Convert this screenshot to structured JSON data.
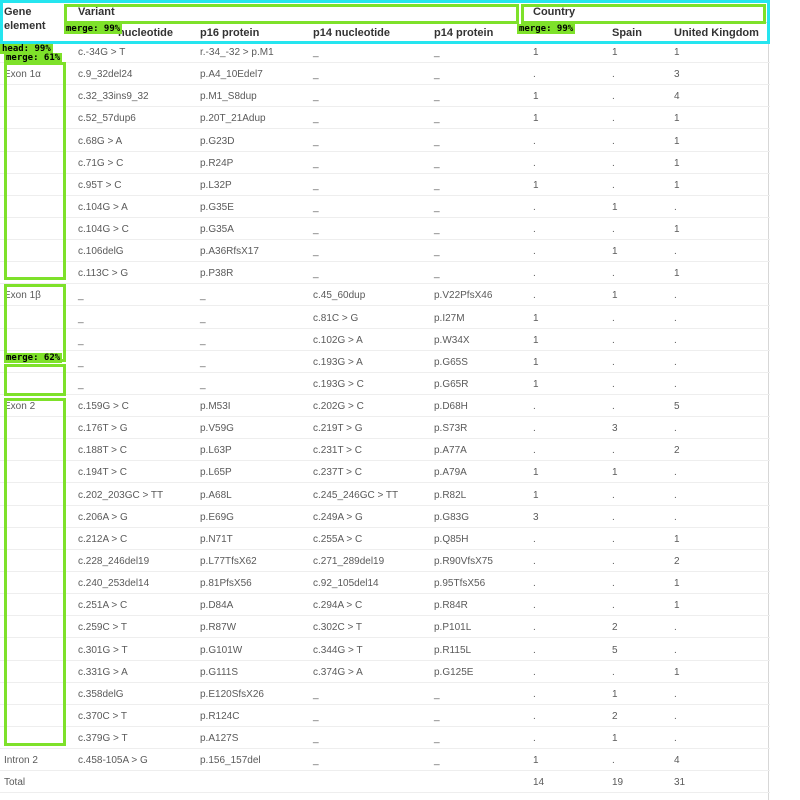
{
  "header": {
    "gene_element_line1": "Gene",
    "gene_element_line2": "element",
    "variant": "Variant",
    "country": "Country",
    "columns": [
      "nucleotide",
      "p16 protein",
      "p14 nucleotide",
      "p14 protein",
      "",
      "Spain",
      "United Kingdom"
    ]
  },
  "rows": [
    {
      "group": "",
      "c1": "c.-34G > T",
      "c2": "r.-34_-32 > p.M1",
      "c3": "_",
      "c4": "_",
      "c5": "1",
      "c6": "1",
      "c7": "1"
    },
    {
      "group": "Exon 1α",
      "c1": "c.9_32del24",
      "c2": "p.A4_10Edel7",
      "c3": "_",
      "c4": "_",
      "c5": ".",
      "c6": ".",
      "c7": "3"
    },
    {
      "group": "",
      "c1": "c.32_33ins9_32",
      "c2": "p.M1_S8dup",
      "c3": "_",
      "c4": "_",
      "c5": "1",
      "c6": ".",
      "c7": "4"
    },
    {
      "group": "",
      "c1": "c.52_57dup6",
      "c2": "p.20T_21Adup",
      "c3": "_",
      "c4": "_",
      "c5": "1",
      "c6": ".",
      "c7": "1"
    },
    {
      "group": "",
      "c1": "c.68G > A",
      "c2": "p.G23D",
      "c3": "_",
      "c4": "_",
      "c5": ".",
      "c6": ".",
      "c7": "1"
    },
    {
      "group": "",
      "c1": "c.71G > C",
      "c2": "p.R24P",
      "c3": "_",
      "c4": "_",
      "c5": ".",
      "c6": ".",
      "c7": "1"
    },
    {
      "group": "",
      "c1": "c.95T > C",
      "c2": "p.L32P",
      "c3": "_",
      "c4": "_",
      "c5": "1",
      "c6": ".",
      "c7": "1"
    },
    {
      "group": "",
      "c1": "c.104G > A",
      "c2": "p.G35E",
      "c3": "_",
      "c4": "_",
      "c5": ".",
      "c6": "1",
      "c7": "."
    },
    {
      "group": "",
      "c1": "c.104G > C",
      "c2": "p.G35A",
      "c3": "_",
      "c4": "_",
      "c5": ".",
      "c6": ".",
      "c7": "1"
    },
    {
      "group": "",
      "c1": "c.106delG",
      "c2": "p.A36RfsX17",
      "c3": "_",
      "c4": "_",
      "c5": ".",
      "c6": "1",
      "c7": "."
    },
    {
      "group": "",
      "c1": "c.113C > G",
      "c2": "p.P38R",
      "c3": "_",
      "c4": "_",
      "c5": ".",
      "c6": ".",
      "c7": "1"
    },
    {
      "group": "Exon 1β",
      "c1": "_",
      "c2": "_",
      "c3": "c.45_60dup",
      "c4": "p.V22PfsX46",
      "c5": ".",
      "c6": "1",
      "c7": "."
    },
    {
      "group": "",
      "c1": "_",
      "c2": "_",
      "c3": "c.81C > G",
      "c4": "p.I27M",
      "c5": "1",
      "c6": ".",
      "c7": "."
    },
    {
      "group": "",
      "c1": "_",
      "c2": "_",
      "c3": "c.102G > A",
      "c4": "p.W34X",
      "c5": "1",
      "c6": ".",
      "c7": "."
    },
    {
      "group": "",
      "c1": "_",
      "c2": "_",
      "c3": "c.193G > A",
      "c4": "p.G65S",
      "c5": "1",
      "c6": ".",
      "c7": "."
    },
    {
      "group": "",
      "c1": "_",
      "c2": "_",
      "c3": "c.193G > C",
      "c4": "p.G65R",
      "c5": "1",
      "c6": ".",
      "c7": "."
    },
    {
      "group": "Exon 2",
      "c1": "c.159G > C",
      "c2": "p.M53I",
      "c3": "c.202G > C",
      "c4": "p.D68H",
      "c5": ".",
      "c6": ".",
      "c7": "5"
    },
    {
      "group": "",
      "c1": "c.176T > G",
      "c2": "p.V59G",
      "c3": "c.219T > G",
      "c4": "p.S73R",
      "c5": ".",
      "c6": "3",
      "c7": "."
    },
    {
      "group": "",
      "c1": "c.188T > C",
      "c2": "p.L63P",
      "c3": "c.231T > C",
      "c4": "p.A77A",
      "c5": ".",
      "c6": ".",
      "c7": "2"
    },
    {
      "group": "",
      "c1": "c.194T > C",
      "c2": "p.L65P",
      "c3": "c.237T > C",
      "c4": "p.A79A",
      "c5": "1",
      "c6": "1",
      "c7": "."
    },
    {
      "group": "",
      "c1": "c.202_203GC > TT",
      "c2": "p.A68L",
      "c3": "c.245_246GC > TT",
      "c4": "p.R82L",
      "c5": "1",
      "c6": ".",
      "c7": "."
    },
    {
      "group": "",
      "c1": "c.206A > G",
      "c2": "p.E69G",
      "c3": "c.249A > G",
      "c4": "p.G83G",
      "c5": "3",
      "c6": ".",
      "c7": "."
    },
    {
      "group": "",
      "c1": "c.212A > C",
      "c2": "p.N71T",
      "c3": "c.255A > C",
      "c4": "p.Q85H",
      "c5": ".",
      "c6": ".",
      "c7": "1"
    },
    {
      "group": "",
      "c1": "c.228_246del19",
      "c2": "p.L77TfsX62",
      "c3": "c.271_289del19",
      "c4": "p.R90VfsX75",
      "c5": ".",
      "c6": ".",
      "c7": "2"
    },
    {
      "group": "",
      "c1": "c.240_253del14",
      "c2": "p.81PfsX56",
      "c3": "c.92_105del14",
      "c4": "p.95TfsX56",
      "c5": ".",
      "c6": ".",
      "c7": "1"
    },
    {
      "group": "",
      "c1": "c.251A > C",
      "c2": "p.D84A",
      "c3": "c.294A > C",
      "c4": "p.R84R",
      "c5": ".",
      "c6": ".",
      "c7": "1"
    },
    {
      "group": "",
      "c1": "c.259C > T",
      "c2": "p.R87W",
      "c3": "c.302C > T",
      "c4": "p.P101L",
      "c5": ".",
      "c6": "2",
      "c7": "."
    },
    {
      "group": "",
      "c1": "c.301G > T",
      "c2": "p.G101W",
      "c3": "c.344G > T",
      "c4": "p.R115L",
      "c5": ".",
      "c6": "5",
      "c7": "."
    },
    {
      "group": "",
      "c1": "c.331G > A",
      "c2": "p.G111S",
      "c3": "c.374G > A",
      "c4": "p.G125E",
      "c5": ".",
      "c6": ".",
      "c7": "1"
    },
    {
      "group": "",
      "c1": "c.358delG",
      "c2": "p.E120SfsX26",
      "c3": "_",
      "c4": "_",
      "c5": ".",
      "c6": "1",
      "c7": "."
    },
    {
      "group": "",
      "c1": "c.370C > T",
      "c2": "p.R124C",
      "c3": "_",
      "c4": "_",
      "c5": ".",
      "c6": "2",
      "c7": "."
    },
    {
      "group": "",
      "c1": "c.379G > T",
      "c2": "p.A127S",
      "c3": "_",
      "c4": "_",
      "c5": ".",
      "c6": "1",
      "c7": "."
    },
    {
      "group": "Intron 2",
      "c1": "c.458-105A > G",
      "c2": "p.156_157del",
      "c3": "_",
      "c4": "_",
      "c5": "1",
      "c6": ".",
      "c7": "4"
    },
    {
      "group": "Total",
      "c1": "",
      "c2": "",
      "c3": "",
      "c4": "",
      "c5": "14",
      "c6": "19",
      "c7": "31"
    }
  ],
  "overlays": {
    "head_label": "head: 99%",
    "merge_variant": "merge: 99%",
    "merge_country": "merge: 99%",
    "merge_exon1a": "merge: 61%",
    "merge_exon1b": "merge: 62%"
  },
  "colors": {
    "overlay_cyan": "#25e5ef",
    "overlay_green": "#7ee12a"
  }
}
